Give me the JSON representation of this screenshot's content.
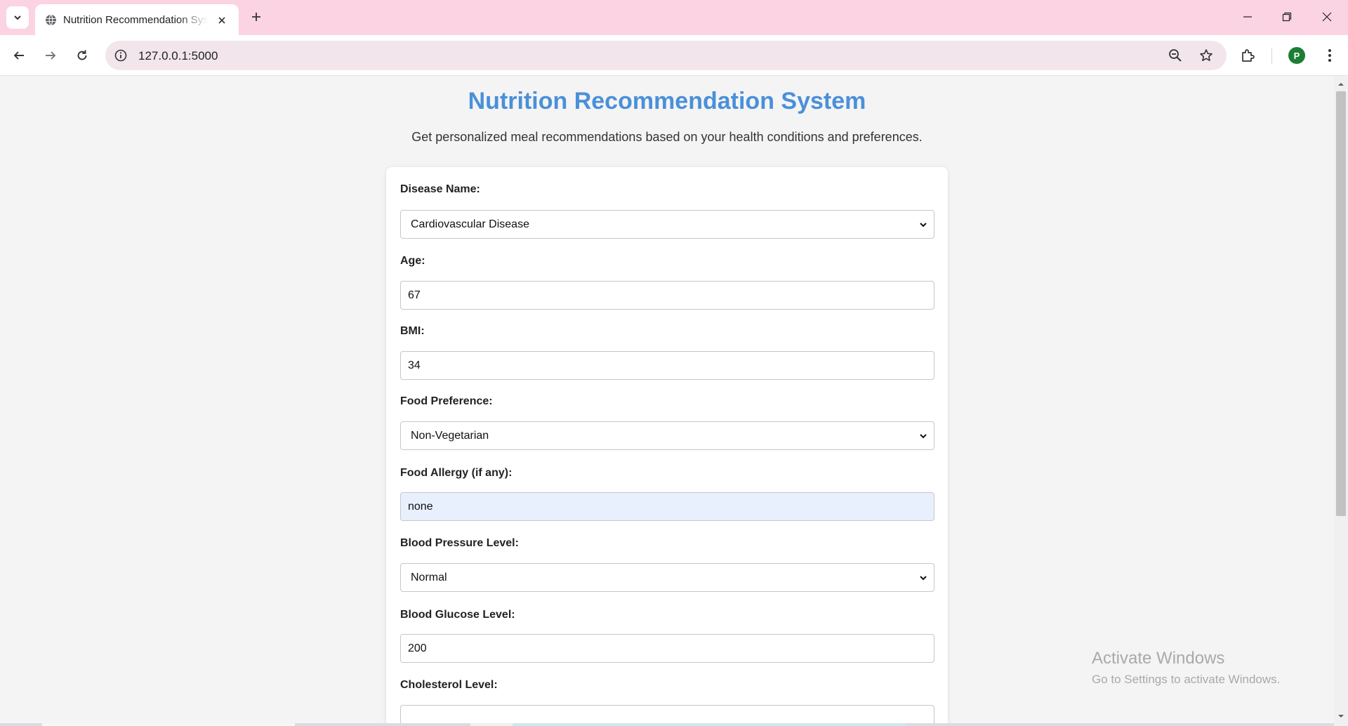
{
  "browser": {
    "tab_title": "Nutrition Recommendation System",
    "url": "127.0.0.1:5000",
    "profile_initial": "P",
    "icons": {
      "tab_list": "chevron-down-icon",
      "favicon": "globe-icon",
      "tab_close": "close-icon",
      "new_tab": "plus-icon",
      "back": "arrow-left-icon",
      "forward": "arrow-right-icon",
      "reload": "reload-icon",
      "site_info": "info-icon",
      "zoom": "zoom-out-icon",
      "bookmark": "star-icon",
      "extensions": "puzzle-icon",
      "menu": "kebab-icon"
    }
  },
  "page": {
    "title": "Nutrition Recommendation System",
    "subtitle": "Get personalized meal recommendations based on your health conditions and preferences.",
    "title_color": "#4a90d9"
  },
  "form": {
    "fields": [
      {
        "label": "Disease Name:",
        "type": "select",
        "value": "Cardiovascular Disease"
      },
      {
        "label": "Age:",
        "type": "input",
        "value": "67"
      },
      {
        "label": "BMI:",
        "type": "input",
        "value": "34"
      },
      {
        "label": "Food Preference:",
        "type": "select",
        "value": "Non-Vegetarian"
      },
      {
        "label": "Food Allergy (if any):",
        "type": "input",
        "value": "none"
      },
      {
        "label": "Blood Pressure Level:",
        "type": "select",
        "value": "Normal"
      },
      {
        "label": "Blood Glucose Level:",
        "type": "input",
        "value": "200"
      },
      {
        "label": "Cholesterol Level:",
        "type": "input",
        "value": ""
      }
    ]
  },
  "watermark": {
    "line1": "Activate Windows",
    "line2": "Go to Settings to activate Windows."
  }
}
